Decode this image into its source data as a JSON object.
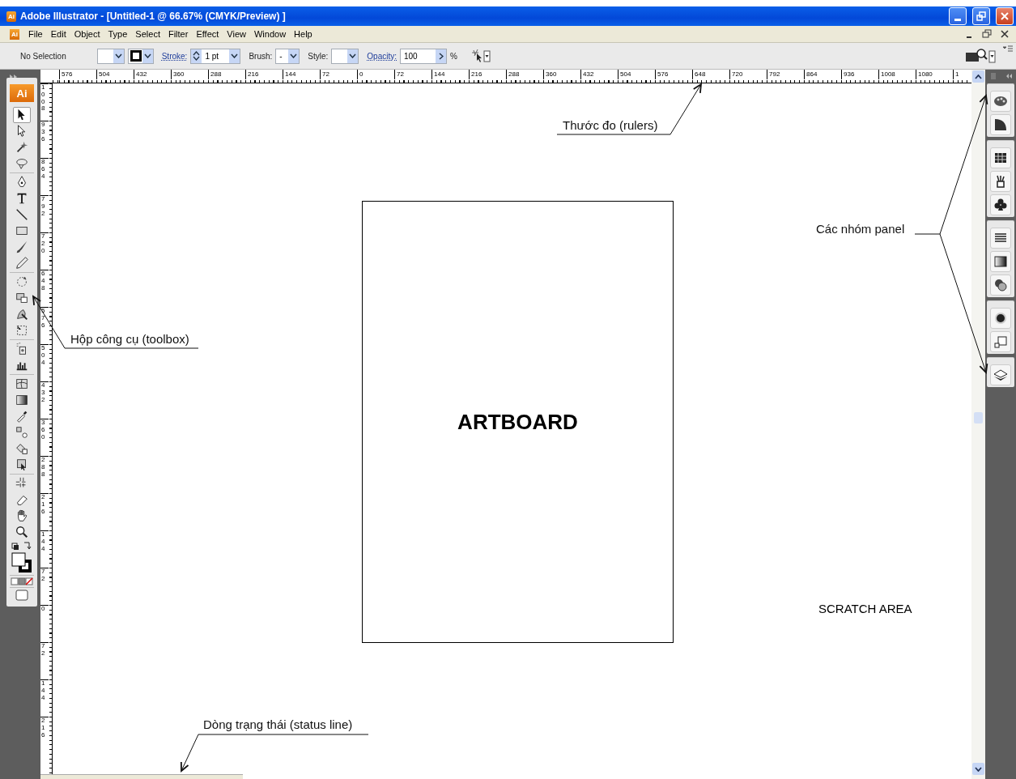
{
  "window": {
    "app_badge": "Ai",
    "title": "Adobe Illustrator - [Untitled-1 @ 66.67% (CMYK/Preview) ]"
  },
  "menu": {
    "app_badge": "Ai",
    "items": [
      "File",
      "Edit",
      "Object",
      "Type",
      "Select",
      "Filter",
      "Effect",
      "View",
      "Window",
      "Help"
    ]
  },
  "control_bar": {
    "selection": "No Selection",
    "stroke_label": "Stroke:",
    "stroke_value": "1 pt",
    "brush_label": "Brush:",
    "brush_value": "-",
    "style_label": "Style:",
    "opacity_label": "Opacity:",
    "opacity_value": "100",
    "opacity_unit": "%"
  },
  "rulers": {
    "horizontal": [
      "576",
      "504",
      "432",
      "360",
      "288",
      "216",
      "144",
      "72",
      "0",
      "72",
      "144",
      "216",
      "288",
      "360",
      "432",
      "504",
      "576",
      "648",
      "720",
      "792",
      "864",
      "936",
      "1008",
      "1080",
      "1"
    ],
    "vertical": [
      "1008",
      "936",
      "864",
      "792",
      "720",
      "648",
      "576",
      "504",
      "432",
      "360",
      "288",
      "216",
      "144",
      "72",
      "0",
      "72",
      "144",
      "216"
    ]
  },
  "toolbox": {
    "logo": "Ai"
  },
  "canvas": {
    "artboard_label": "ARTBOARD",
    "scratch_label": "SCRATCH AREA"
  },
  "annotations": [
    {
      "text": "Thước đo (rulers)"
    },
    {
      "text": "Các nhóm panel"
    },
    {
      "text": "Hộp công cụ (toolbox)"
    },
    {
      "text": "Dòng trạng thái (status line)"
    }
  ]
}
